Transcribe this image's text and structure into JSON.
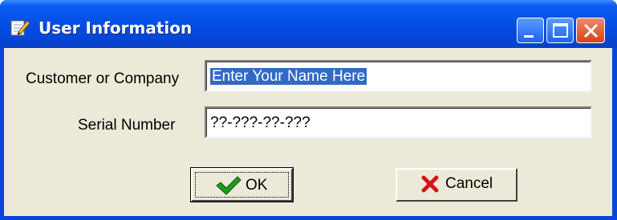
{
  "window": {
    "title": "User Information",
    "title_icon": "notepad-pencil-icon"
  },
  "controls": {
    "minimize_icon": "minimize-icon",
    "maximize_icon": "maximize-icon",
    "close_icon": "close-icon"
  },
  "form": {
    "customer_label": "Customer or Company",
    "customer_value": "Enter Your Name Here",
    "serial_label": "Serial Number",
    "serial_value": "??-???-??-???"
  },
  "buttons": {
    "ok_label": "OK",
    "ok_icon": "checkmark-icon",
    "cancel_label": "Cancel",
    "cancel_icon": "x-mark-icon"
  },
  "colors": {
    "titlebar": "#0550e6",
    "client_bg": "#ece9d8",
    "selection": "#316ac5",
    "check_green": "#1f9a1f",
    "cancel_red": "#d01818"
  }
}
